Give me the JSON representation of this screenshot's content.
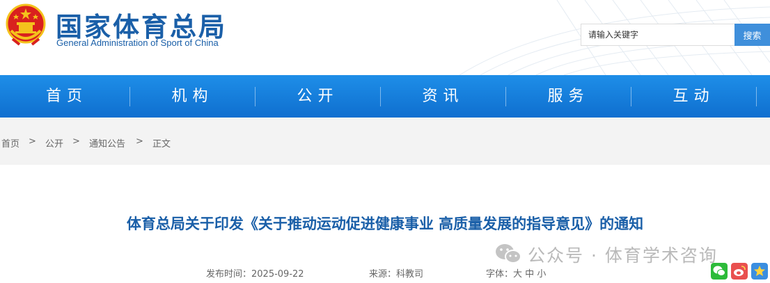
{
  "header": {
    "site_name_cn": "国家体育总局",
    "site_name_en": "General Administration of Sport of China",
    "emblem_icon": "national-emblem-icon"
  },
  "search": {
    "placeholder": "请输入关键字",
    "button_label": "搜索"
  },
  "nav": {
    "items": [
      {
        "label": "首页"
      },
      {
        "label": "机构"
      },
      {
        "label": "公开"
      },
      {
        "label": "资讯"
      },
      {
        "label": "服务"
      },
      {
        "label": "互动"
      }
    ]
  },
  "breadcrumb": {
    "items": [
      {
        "label": "首页"
      },
      {
        "label": "公开"
      },
      {
        "label": "通知公告"
      },
      {
        "label": "正文"
      }
    ],
    "separator": ">"
  },
  "article": {
    "title": "体育总局关于印发《关于推动运动促进健康事业 高质量发展的指导意见》的通知",
    "publish_time": "发布时间：2025-09-22",
    "source": "来源：科教司",
    "font_size_label": "字体：",
    "font_large": "大",
    "font_medium": "中",
    "font_small": "小"
  },
  "watermark": {
    "text": "公众号 · 体育学术咨询",
    "icon": "wechat-icon"
  },
  "share": {
    "icons": [
      "wechat-icon",
      "weibo-icon",
      "star-icon"
    ]
  },
  "colors": {
    "brand_blue": "#1a5fa8",
    "nav_blue": "#1580e0",
    "search_button": "#3f8fdb",
    "breadcrumb_bg": "#f3f3f3"
  }
}
